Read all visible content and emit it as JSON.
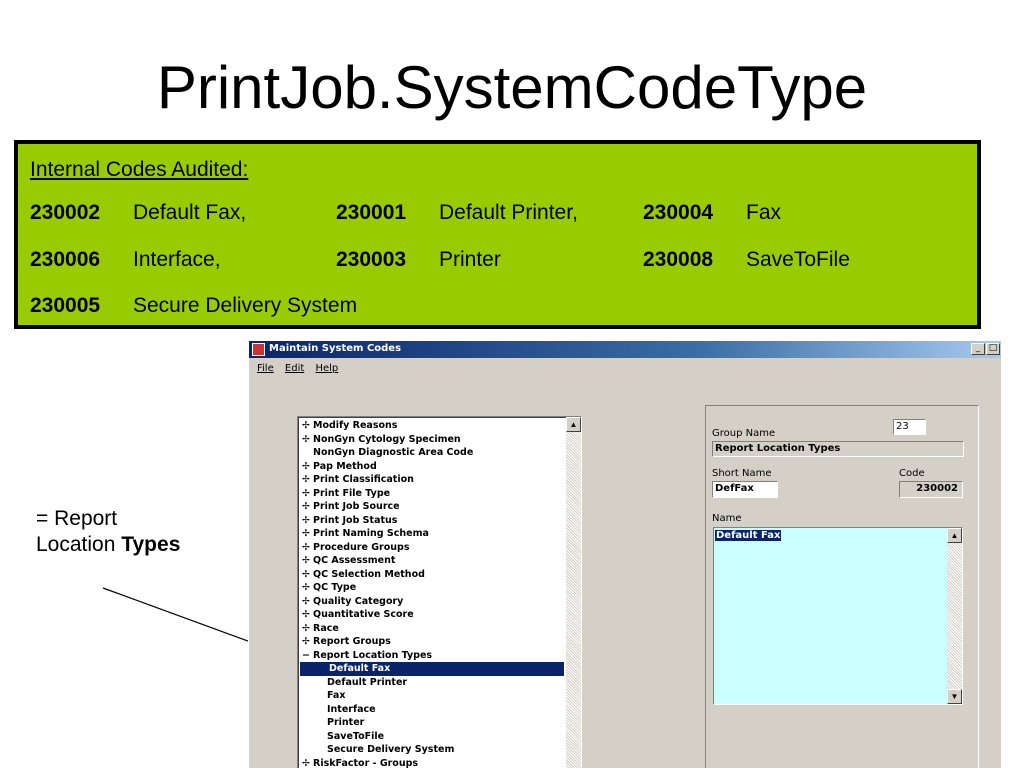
{
  "slide": {
    "title": "PrintJob.SystemCodeType"
  },
  "codes_box": {
    "heading": "Internal Codes Audited:",
    "rows": [
      [
        {
          "code": "230002",
          "label": "Default Fax,"
        },
        {
          "code": "230001",
          "label": "Default Printer,"
        },
        {
          "code": "230004",
          "label": "Fax"
        }
      ],
      [
        {
          "code": "230006",
          "label": "Interface,"
        },
        {
          "code": "230003",
          "label": "Printer"
        },
        {
          "code": "230008",
          "label": "SaveToFile"
        }
      ],
      [
        {
          "code": "230005",
          "label": "Secure Delivery System"
        }
      ]
    ],
    "background_color": "#99cc00"
  },
  "annotation": {
    "line1": "= Report",
    "line2_prefix": "Location ",
    "line2_bold": "Types"
  },
  "window": {
    "title": "Maintain System Codes",
    "menu": [
      "File",
      "Edit",
      "Help"
    ],
    "titlebar_color": "#0a246a",
    "tree_items": [
      {
        "label": "Modify Reasons",
        "level": 0,
        "expander": "plus"
      },
      {
        "label": "NonGyn Cytology Specimen",
        "level": 0,
        "expander": "plus"
      },
      {
        "label": "NonGyn Diagnostic Area Code",
        "level": 0,
        "expander": "none"
      },
      {
        "label": "Pap Method",
        "level": 0,
        "expander": "plus"
      },
      {
        "label": "Print Classification",
        "level": 0,
        "expander": "plus"
      },
      {
        "label": "Print File Type",
        "level": 0,
        "expander": "plus"
      },
      {
        "label": "Print Job Source",
        "level": 0,
        "expander": "plus"
      },
      {
        "label": "Print Job Status",
        "level": 0,
        "expander": "plus"
      },
      {
        "label": "Print Naming Schema",
        "level": 0,
        "expander": "plus"
      },
      {
        "label": "Procedure Groups",
        "level": 0,
        "expander": "plus"
      },
      {
        "label": "QC Assessment",
        "level": 0,
        "expander": "plus"
      },
      {
        "label": "QC Selection Method",
        "level": 0,
        "expander": "plus"
      },
      {
        "label": "QC Type",
        "level": 0,
        "expander": "plus"
      },
      {
        "label": "Quality Category",
        "level": 0,
        "expander": "plus"
      },
      {
        "label": "Quantitative Score",
        "level": 0,
        "expander": "plus"
      },
      {
        "label": "Race",
        "level": 0,
        "expander": "plus"
      },
      {
        "label": "Report Groups",
        "level": 0,
        "expander": "plus"
      },
      {
        "label": "Report Location Types",
        "level": 0,
        "expander": "minus"
      },
      {
        "label": "Default Fax",
        "level": 1,
        "expander": "none",
        "selected": true
      },
      {
        "label": "Default Printer",
        "level": 1,
        "expander": "none"
      },
      {
        "label": "Fax",
        "level": 1,
        "expander": "none"
      },
      {
        "label": "Interface",
        "level": 1,
        "expander": "none"
      },
      {
        "label": "Printer",
        "level": 1,
        "expander": "none"
      },
      {
        "label": "SaveToFile",
        "level": 1,
        "expander": "none"
      },
      {
        "label": "Secure Delivery System",
        "level": 1,
        "expander": "none"
      },
      {
        "label": "RiskFactor - Groups",
        "level": 0,
        "expander": "plus"
      }
    ],
    "detail": {
      "group_name_label": "Group Name",
      "group_id": "23",
      "group_name_value": "Report Location Types",
      "short_name_label": "Short Name",
      "short_name_value": "DefFax",
      "code_label": "Code",
      "code_value": "230002",
      "name_label": "Name",
      "name_value": "Default Fax",
      "name_bg_color": "#ccffff"
    }
  }
}
